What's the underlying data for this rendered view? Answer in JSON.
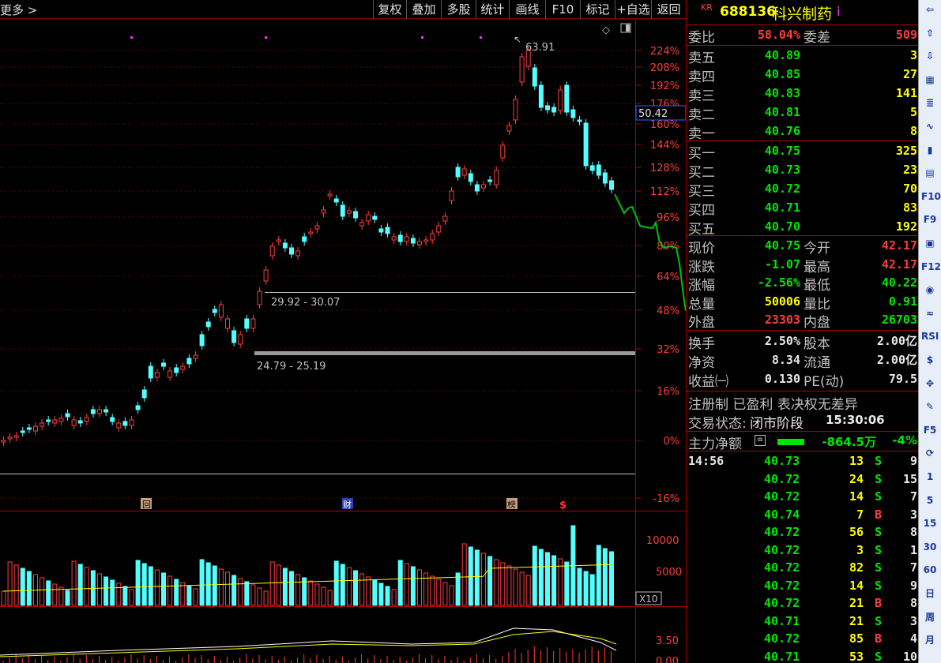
{
  "topbar": {
    "more_label": "更多 >",
    "buttons": [
      "复权",
      "叠加",
      "多股",
      "统计",
      "画线",
      "F10",
      "标记",
      "+自选",
      "返回"
    ]
  },
  "colors": {
    "up": "#ff3c3c",
    "down": "#54ffff",
    "ma1": "#ffffff",
    "ma2": "#ffff00",
    "projection": "#00c000"
  },
  "chart": {
    "price_axis": [
      "224%",
      "208%",
      "192%",
      "176%",
      "160%",
      "144%",
      "128%",
      "112%",
      "96%",
      "80%",
      "64%",
      "48%",
      "32%",
      "16%",
      "0%",
      "-16%"
    ],
    "cursor_price": "50.42",
    "high_label": "63.91",
    "range_labels": [
      "29.92 - 30.07",
      "24.79 - 25.19"
    ],
    "event_markers": [
      "回",
      "财",
      "榜",
      "$"
    ],
    "volume_axis": [
      "10000",
      "5000"
    ],
    "volume_unit": "X10",
    "indicator_axis": [
      "3.50",
      "0.00"
    ]
  },
  "quote": {
    "market": "KR",
    "code": "688136",
    "name": "科兴制药",
    "info_icon": "i",
    "weibi_label": "委比",
    "weibi": "58.04%",
    "weicha_label": "委差",
    "weicha": "509",
    "asks": [
      {
        "label": "卖五",
        "price": "40.89",
        "vol": "3"
      },
      {
        "label": "卖四",
        "price": "40.85",
        "vol": "27"
      },
      {
        "label": "卖三",
        "price": "40.83",
        "vol": "141"
      },
      {
        "label": "卖二",
        "price": "40.81",
        "vol": "5"
      },
      {
        "label": "卖一",
        "price": "40.76",
        "vol": "8"
      }
    ],
    "bids": [
      {
        "label": "买一",
        "price": "40.75",
        "vol": "325"
      },
      {
        "label": "买二",
        "price": "40.73",
        "vol": "23"
      },
      {
        "label": "买三",
        "price": "40.72",
        "vol": "70"
      },
      {
        "label": "买四",
        "price": "40.71",
        "vol": "83"
      },
      {
        "label": "买五",
        "price": "40.70",
        "vol": "192"
      }
    ],
    "stats": [
      {
        "l1": "现价",
        "v1": "40.75",
        "c1": "green",
        "l2": "今开",
        "v2": "42.17",
        "c2": "red"
      },
      {
        "l1": "涨跌",
        "v1": "-1.07",
        "c1": "green",
        "l2": "最高",
        "v2": "42.17",
        "c2": "red"
      },
      {
        "l1": "涨幅",
        "v1": "-2.56%",
        "c1": "green",
        "l2": "最低",
        "v2": "40.22",
        "c2": "green"
      },
      {
        "l1": "总量",
        "v1": "50006",
        "c1": "yellow",
        "l2": "量比",
        "v2": "0.91",
        "c2": "green"
      },
      {
        "l1": "外盘",
        "v1": "23303",
        "c1": "red",
        "l2": "内盘",
        "v2": "26703",
        "c2": "green"
      }
    ],
    "fund": [
      {
        "l1": "换手",
        "v1": "2.50%",
        "l2": "股本",
        "v2": "2.00亿"
      },
      {
        "l1": "净资",
        "v1": "8.34",
        "l2": "流通",
        "v2": "2.00亿"
      },
      {
        "l1": "收益㈠",
        "v1": "0.130",
        "l2": "PE(动)",
        "v2": "79.5"
      }
    ],
    "registration": "注册制 已盈利 表决权无差异",
    "trade_status_label": "交易状态:",
    "trade_status": "闭市阶段",
    "trade_time": "15:30:06",
    "main_fund_label": "主力净额",
    "main_fund_value": "-864.5万",
    "main_fund_pct": "-4%"
  },
  "ticks": [
    {
      "time": "14:56",
      "price": "40.73",
      "vol": "13",
      "side": "S",
      "n": "9"
    },
    {
      "time": "",
      "price": "40.72",
      "vol": "24",
      "side": "S",
      "n": "15"
    },
    {
      "time": "",
      "price": "40.72",
      "vol": "14",
      "side": "S",
      "n": "7"
    },
    {
      "time": "",
      "price": "40.74",
      "vol": "7",
      "side": "B",
      "n": "3"
    },
    {
      "time": "",
      "price": "40.72",
      "vol": "56",
      "side": "S",
      "n": "8"
    },
    {
      "time": "",
      "price": "40.72",
      "vol": "3",
      "side": "S",
      "n": "1"
    },
    {
      "time": "",
      "price": "40.72",
      "vol": "82",
      "side": "S",
      "n": "7"
    },
    {
      "time": "",
      "price": "40.72",
      "vol": "14",
      "side": "S",
      "n": "9"
    },
    {
      "time": "",
      "price": "40.72",
      "vol": "21",
      "side": "B",
      "n": "8"
    },
    {
      "time": "",
      "price": "40.71",
      "vol": "21",
      "side": "S",
      "n": "3"
    },
    {
      "time": "",
      "price": "40.72",
      "vol": "85",
      "side": "B",
      "n": "4"
    },
    {
      "time": "",
      "price": "40.71",
      "vol": "53",
      "side": "S",
      "n": "10"
    }
  ],
  "toolbar": [
    "⇦",
    "⇧",
    "⇩",
    "▦",
    "≣",
    "∿",
    "▮",
    "▤",
    "F10",
    "F9",
    "▣",
    "F12",
    "◉",
    "≈",
    "RSI",
    "$",
    "✥",
    "✎",
    "F5",
    "⟳",
    "1",
    "5",
    "15",
    "30",
    "60",
    "日",
    "周",
    "月"
  ]
}
